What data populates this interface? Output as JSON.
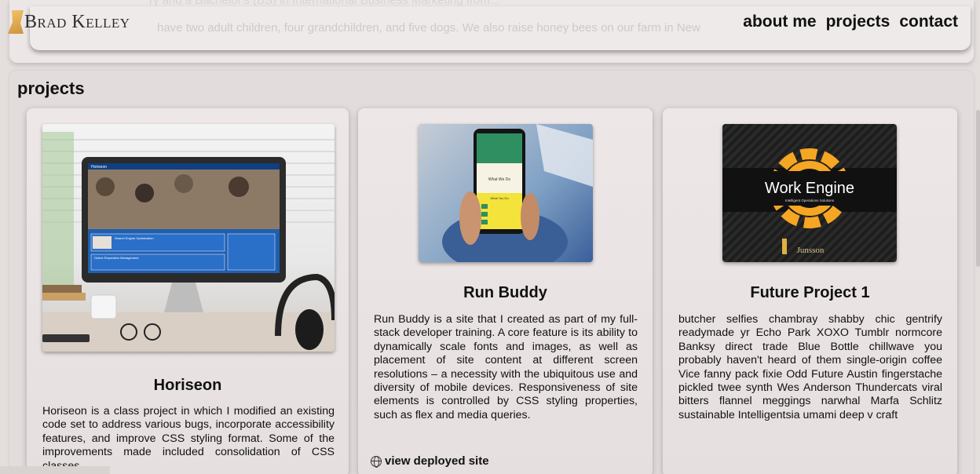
{
  "header": {
    "logo": "Brad Kelley",
    "logo_monogram": "BK",
    "nav": [
      "about me",
      "projects",
      "contact"
    ]
  },
  "about": {
    "partial_text": "have two adult children, four grandchildren, and five dogs. We also raise honey bees on our farm in New",
    "partial_text_top": "ry and a Bachelor's (BS) in International Business Marketing from..."
  },
  "projects": {
    "title": "projects",
    "items": [
      {
        "name": "Horiseon",
        "description": "Horiseon is a class project in which I modified an existing code set to address various bugs, incorporate accessibility features, and improve CSS styling format. Some of the improvements made included consolidation of CSS classes.",
        "thumb": {
          "header": "Horiseon",
          "item1": "Search Engine Optimization",
          "item2": "Online Reputation Management"
        }
      },
      {
        "name": "Run Buddy",
        "description": "Run Buddy is a site that I created as part of my full-stack developer training. A core feature is its ability to dynamically scale fonts and images, as well as placement of site content at different screen resolutions – a necessity with the ubiquitous use and diversity of mobile devices. Responsiveness of site elements is controlled by CSS styling properties, such as flex and media queries.",
        "link": "view deployed site",
        "thumb": {
          "title": "What We Do",
          "sub": "What You Do"
        }
      },
      {
        "name": "Future Project 1",
        "description": "butcher selfies chambray shabby chic gentrify readymade yr Echo Park XOXO Tumblr normcore Banksy direct trade Blue Bottle chillwave you probably haven't heard of them single-origin coffee Vice fanny pack fixie Odd Future Austin fingerstache pickled twee synth Wes Anderson Thundercats viral bitters flannel meggings narwhal Marfa Schlitz sustainable Intelligentsia umami deep v craft",
        "thumb": {
          "title": "Work Engine",
          "subtitle": "Intelligent Operations Solutions",
          "brand": "Junsson"
        }
      }
    ]
  },
  "colors": {
    "page_bg": "#e4dedd",
    "card_bg": "#ede7e7",
    "accent_orange": "#f5a623",
    "runbuddy_yellow": "#f3e33b"
  }
}
